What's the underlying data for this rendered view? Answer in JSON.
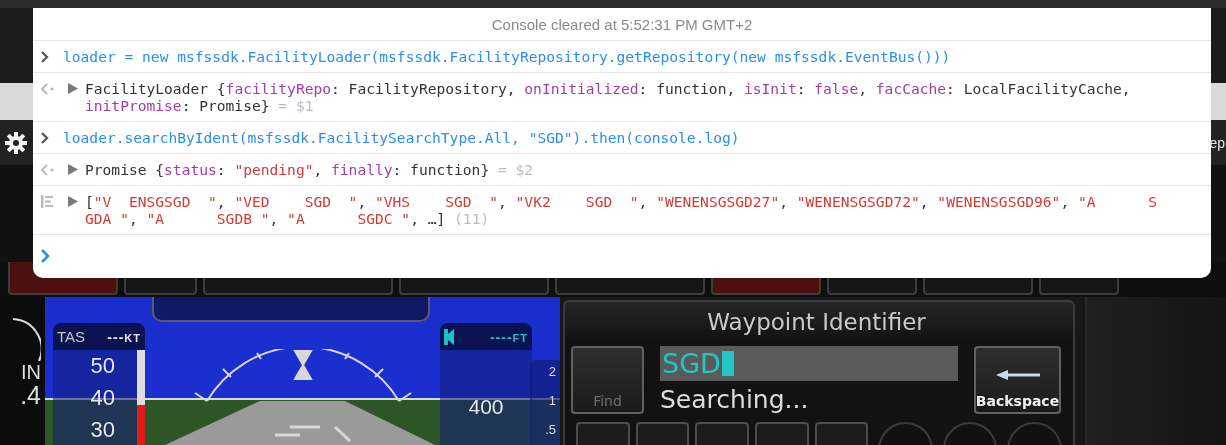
{
  "console": {
    "status": "Console cleared at 5:52:31 PM GMT+2",
    "entries": [
      {
        "kind": "input",
        "tokens": [
          {
            "kind": "code",
            "text": "loader = new msfssdk.FacilityLoader(msfssdk.FacilityRepository.getRepository(new msfssdk.EventBus()))"
          }
        ]
      },
      {
        "kind": "result",
        "expanded": false,
        "tokens": [
          {
            "kind": "plain",
            "text": "FacilityLoader {"
          },
          {
            "kind": "key",
            "text": "facilityRepo"
          },
          {
            "kind": "plain",
            "text": ": FacilityRepository, "
          },
          {
            "kind": "key",
            "text": "onInitialized"
          },
          {
            "kind": "plain",
            "text": ": function, "
          },
          {
            "kind": "key",
            "text": "isInit"
          },
          {
            "kind": "plain",
            "text": ": "
          },
          {
            "kind": "keyword",
            "text": "false"
          },
          {
            "kind": "plain",
            "text": ", "
          },
          {
            "kind": "key",
            "text": "facCache"
          },
          {
            "kind": "plain",
            "text": ": LocalFacilityCache, "
          },
          {
            "kind": "key",
            "text": "initPromise"
          },
          {
            "kind": "plain",
            "text": ": Promise}"
          },
          {
            "kind": "hint",
            "text": " = $1"
          }
        ]
      },
      {
        "kind": "input",
        "tokens": [
          {
            "kind": "code",
            "text": "loader.searchByIdent(msfssdk.FacilitySearchType.All, \"SGD\").then(console.log)"
          }
        ]
      },
      {
        "kind": "result",
        "expanded": false,
        "tokens": [
          {
            "kind": "plain",
            "text": "Promise {"
          },
          {
            "kind": "key",
            "text": "status"
          },
          {
            "kind": "plain",
            "text": ": "
          },
          {
            "kind": "string",
            "text": "\"pending\""
          },
          {
            "kind": "plain",
            "text": ", "
          },
          {
            "kind": "key",
            "text": "finally"
          },
          {
            "kind": "plain",
            "text": ": function}"
          },
          {
            "kind": "hint",
            "text": " = $2"
          }
        ]
      },
      {
        "kind": "log",
        "expanded": false,
        "tokens": [
          {
            "kind": "plain",
            "text": "["
          },
          {
            "kind": "string",
            "text": "\"V  ENSGSGD  \""
          },
          {
            "kind": "plain",
            "text": ", "
          },
          {
            "kind": "string",
            "text": "\"VED    SGD  \""
          },
          {
            "kind": "plain",
            "text": ", "
          },
          {
            "kind": "string",
            "text": "\"VHS    SGD  \""
          },
          {
            "kind": "plain",
            "text": ", "
          },
          {
            "kind": "string",
            "text": "\"VK2    SGD  \""
          },
          {
            "kind": "plain",
            "text": ", "
          },
          {
            "kind": "string",
            "text": "\"WENENSGSGD27\""
          },
          {
            "kind": "plain",
            "text": ", "
          },
          {
            "kind": "string",
            "text": "\"WENENSGSGD72\""
          },
          {
            "kind": "plain",
            "text": ", "
          },
          {
            "kind": "string",
            "text": "\"WENENSGSGD96\""
          },
          {
            "kind": "plain",
            "text": ", "
          },
          {
            "kind": "string",
            "text": "\"A      SGDA \""
          },
          {
            "kind": "plain",
            "text": ", "
          },
          {
            "kind": "string",
            "text": "\"A      SGDB \""
          },
          {
            "kind": "plain",
            "text": ", "
          },
          {
            "kind": "string",
            "text": "\"A      SGDC \""
          },
          {
            "kind": "plain",
            "text": ", …]"
          },
          {
            "kind": "hint",
            "text": " (11)"
          }
        ]
      }
    ]
  },
  "cockpit": {
    "corner_label": "ep",
    "gauge": {
      "unit": "IN",
      "reading": ".4"
    },
    "pfd": {
      "airspeed": {
        "label": "TAS",
        "value": "---",
        "unit": "KT",
        "ticks": [
          "50",
          "40",
          "30"
        ]
      },
      "altitude": {
        "value": "----",
        "unit": "FT",
        "ticks": [
          "400"
        ]
      },
      "vertical_speed": {
        "ticks": [
          "2",
          "1",
          ".5"
        ]
      }
    },
    "gtc": {
      "title": "Waypoint Identifier",
      "find": {
        "label": "Find",
        "disabled": true
      },
      "field": {
        "value": "SGD"
      },
      "status": "Searching...",
      "backspace": {
        "label": "Backspace"
      }
    }
  }
}
